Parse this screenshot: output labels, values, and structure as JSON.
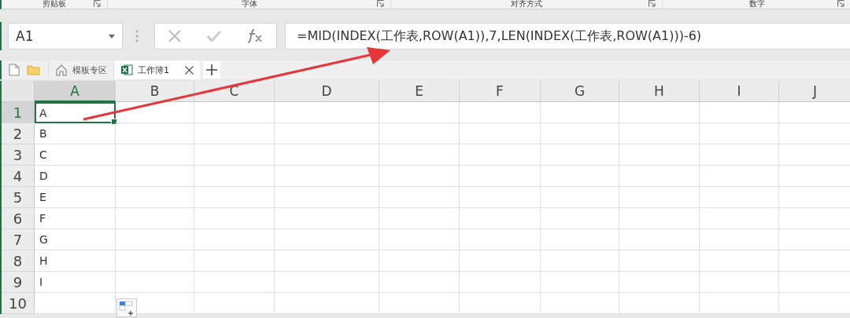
{
  "ribbon_groups": [
    {
      "label": "剪贴板"
    },
    {
      "label": "字体"
    },
    {
      "label": "对齐方式"
    },
    {
      "label": "数字"
    }
  ],
  "formula_bar": {
    "name_box": "A1",
    "formula": "=MID(INDEX(工作表,ROW(A1)),7,LEN(INDEX(工作表,ROW(A1)))-6)"
  },
  "tabs": [
    {
      "label": "模板专区",
      "kind": "home",
      "selected": false
    },
    {
      "label": "工作簿1",
      "kind": "workbook",
      "selected": true
    }
  ],
  "columns": [
    {
      "label": "A",
      "selected": true
    },
    {
      "label": "B",
      "selected": false
    },
    {
      "label": "C",
      "selected": false
    },
    {
      "label": "D",
      "selected": false
    },
    {
      "label": "E",
      "selected": false
    },
    {
      "label": "F",
      "selected": false
    },
    {
      "label": "G",
      "selected": false
    },
    {
      "label": "H",
      "selected": false
    },
    {
      "label": "I",
      "selected": false
    },
    {
      "label": "J",
      "selected": false
    }
  ],
  "rows": [
    {
      "label": "1",
      "value": "A",
      "selected": true
    },
    {
      "label": "2",
      "value": "B",
      "selected": false
    },
    {
      "label": "3",
      "value": "C",
      "selected": false
    },
    {
      "label": "4",
      "value": "D",
      "selected": false
    },
    {
      "label": "5",
      "value": "E",
      "selected": false
    },
    {
      "label": "6",
      "value": "F",
      "selected": false
    },
    {
      "label": "7",
      "value": "G",
      "selected": false
    },
    {
      "label": "8",
      "value": "H",
      "selected": false
    },
    {
      "label": "9",
      "value": "I",
      "selected": false
    },
    {
      "label": "10",
      "selected": false
    }
  ]
}
